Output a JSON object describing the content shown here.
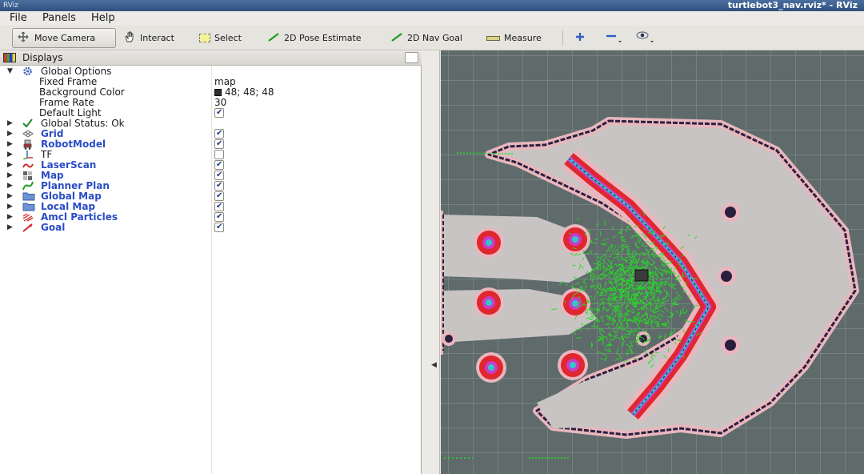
{
  "window": {
    "title": "turtlebot3_nav.rviz* - RViz",
    "app_icon_text": "RViz"
  },
  "menu": [
    "File",
    "Panels",
    "Help"
  ],
  "toolbar": {
    "move_camera": "Move Camera",
    "interact": "Interact",
    "select": "Select",
    "pose_estimate": "2D Pose Estimate",
    "nav_goal": "2D Nav Goal",
    "measure": "Measure"
  },
  "displays_panel": {
    "title": "Displays",
    "global_options": {
      "label": "Global Options",
      "fixed_frame": {
        "name": "Fixed Frame",
        "value": "map"
      },
      "background_color": {
        "name": "Background Color",
        "value": "48; 48; 48"
      },
      "frame_rate": {
        "name": "Frame Rate",
        "value": "30"
      },
      "default_light": {
        "name": "Default Light",
        "checked": true
      }
    },
    "global_status": "Global Status: Ok",
    "items": [
      {
        "label": "Grid",
        "checked": true,
        "icon": "grid-icon"
      },
      {
        "label": "RobotModel",
        "checked": true,
        "icon": "robot-model-icon"
      },
      {
        "label": "TF",
        "checked": false,
        "icon": "tf-icon"
      },
      {
        "label": "LaserScan",
        "checked": true,
        "icon": "laserscan-icon"
      },
      {
        "label": "Map",
        "checked": true,
        "icon": "map-icon"
      },
      {
        "label": "Planner Plan",
        "checked": true,
        "icon": "path-icon"
      },
      {
        "label": "Global Map",
        "checked": true,
        "icon": "folder-icon"
      },
      {
        "label": "Local Map",
        "checked": true,
        "icon": "folder-icon"
      },
      {
        "label": "Amcl Particles",
        "checked": true,
        "icon": "particles-icon"
      },
      {
        "label": "Goal",
        "checked": true,
        "icon": "goal-icon"
      }
    ]
  },
  "colors": {
    "viewport_bg": "#5f6b6a",
    "free_space": "#c8c4c4",
    "wall": "#2b1f3f",
    "inflation_red": "#e0262e",
    "inflation_pink": "#e8b7bd",
    "costmap_cyan": "#33c8c8",
    "costmap_magenta": "#c83cc8",
    "particles": "#22e022",
    "grid_line": "#8e9998"
  }
}
